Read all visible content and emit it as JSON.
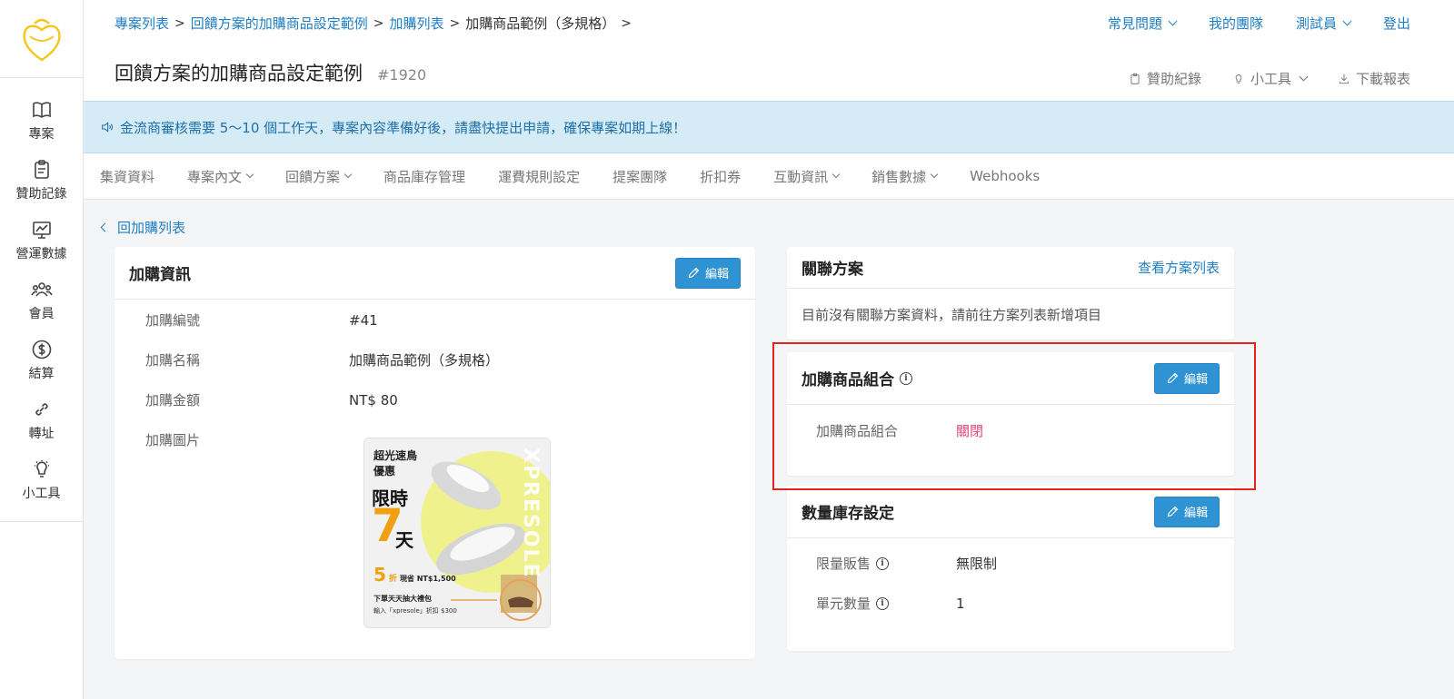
{
  "sidebar": {
    "items": [
      {
        "label": "專案",
        "icon": "book-icon"
      },
      {
        "label": "贊助記錄",
        "icon": "clipboard-icon"
      },
      {
        "label": "營運數據",
        "icon": "chart-icon"
      },
      {
        "label": "會員",
        "icon": "users-icon"
      },
      {
        "label": "結算",
        "icon": "dollar-icon"
      },
      {
        "label": "轉址",
        "icon": "link-icon"
      },
      {
        "label": "小工具",
        "icon": "bulb-icon"
      }
    ]
  },
  "breadcrumb": {
    "items": [
      "專案列表",
      "回饋方案的加購商品設定範例",
      "加購列表"
    ],
    "current": "加購商品範例（多規格）"
  },
  "top_links": {
    "faq": "常見問題",
    "team": "我的團隊",
    "user": "測試員",
    "logout": "登出"
  },
  "page": {
    "title": "回饋方案的加購商品設定範例",
    "id": "#1920"
  },
  "tools": {
    "sponsor_log": "贊助紀錄",
    "widgets": "小工具",
    "download": "下載報表"
  },
  "notice": "金流商審核需要 5～10 個工作天，專案內容準備好後，請盡快提出申請，確保專案如期上線！",
  "tabs": [
    {
      "label": "集資資料",
      "dropdown": false
    },
    {
      "label": "專案內文",
      "dropdown": true
    },
    {
      "label": "回饋方案",
      "dropdown": true
    },
    {
      "label": "商品庫存管理",
      "dropdown": false
    },
    {
      "label": "運費規則設定",
      "dropdown": false
    },
    {
      "label": "提案團隊",
      "dropdown": false
    },
    {
      "label": "折扣券",
      "dropdown": false
    },
    {
      "label": "互動資訊",
      "dropdown": true
    },
    {
      "label": "銷售數據",
      "dropdown": true
    },
    {
      "label": "Webhooks",
      "dropdown": false
    }
  ],
  "back_link": "回加購列表",
  "edit_label": "編輯",
  "addon_info": {
    "title": "加購資訊",
    "rows": [
      {
        "label": "加購編號",
        "value": "#41"
      },
      {
        "label": "加購名稱",
        "value": "加購商品範例（多規格）"
      },
      {
        "label": "加購金額",
        "value": "NT$ 80"
      },
      {
        "label": "加購圖片",
        "value": ""
      }
    ],
    "image": {
      "line1": "超光速鳥",
      "line2": "優惠",
      "line3": "限時",
      "number": "7",
      "unit": "天",
      "discount": "5",
      "discount_unit": "折",
      "save": "現省 NT$1,500",
      "gift": "下單天天抽大禮包",
      "code": "輸入「xpresole」折扣 $300",
      "brand": "XPRESOLE"
    }
  },
  "related": {
    "title": "關聯方案",
    "view_list": "查看方案列表",
    "empty": "目前沒有關聯方案資料，請前往方案列表新增項目"
  },
  "combo": {
    "title": "加購商品組合",
    "label": "加購商品組合",
    "value": "關閉",
    "value_color": "#e8457a"
  },
  "stock": {
    "title": "數量庫存設定",
    "rows": [
      {
        "label": "限量販售",
        "value": "無限制"
      },
      {
        "label": "單元數量",
        "value": "1"
      }
    ]
  },
  "colors": {
    "accent": "#1f7ec4",
    "button": "#2f93d3",
    "notice_bg": "#d5ecf6",
    "highlight": "#e0251b",
    "logo": "#f5c518"
  }
}
